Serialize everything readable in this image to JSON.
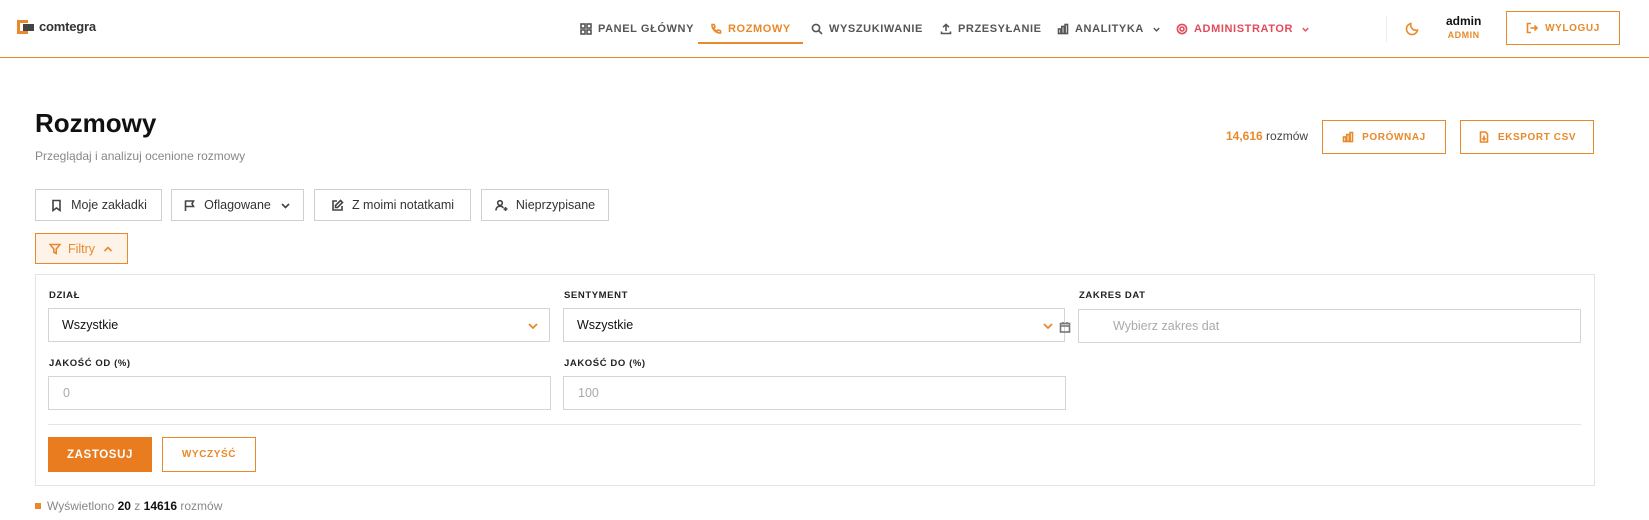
{
  "brand": {
    "name": "comtegra"
  },
  "nav": {
    "items": [
      {
        "label": "PANEL GŁÓWNY",
        "icon": "grid-icon"
      },
      {
        "label": "ROZMOWY",
        "icon": "phone-icon",
        "active": true
      },
      {
        "label": "WYSZUKIWANIE",
        "icon": "search-icon"
      },
      {
        "label": "PRZESYŁANIE",
        "icon": "upload-icon"
      },
      {
        "label": "ANALITYKA",
        "icon": "bar-chart-icon",
        "dropdown": true
      },
      {
        "label": "ADMINISTRATOR",
        "icon": "gear-icon",
        "dropdown": true
      }
    ],
    "theme_icon": "moon-icon",
    "user": {
      "name": "admin",
      "role": "ADMIN"
    },
    "logout_label": "WYLOGUJ"
  },
  "header": {
    "title": "Rozmowy",
    "subtitle": "Przeglądaj i analizuj ocenione rozmowy",
    "count_value": "14,616",
    "count_unit": "rozmów",
    "compare_label": "PORÓWNAJ",
    "export_label": "EKSPORT CSV"
  },
  "quick_filters": {
    "bookmarks": "Moje zakładki",
    "flagged": "Oflagowane",
    "notes": "Z moimi notatkami",
    "unassigned": "Nieprzypisane"
  },
  "filters": {
    "toggle_label": "Filtry",
    "department": {
      "label": "DZIAŁ",
      "value": "Wszystkie"
    },
    "sentiment": {
      "label": "SENTYMENT",
      "value": "Wszystkie"
    },
    "date_range": {
      "label": "ZAKRES DAT",
      "placeholder": "Wybierz zakres dat"
    },
    "quality_from": {
      "label": "JAKOŚĆ OD (%)",
      "placeholder": "0"
    },
    "quality_to": {
      "label": "JAKOŚĆ DO (%)",
      "placeholder": "100"
    },
    "apply_label": "ZASTOSUJ",
    "clear_label": "WYCZYŚĆ"
  },
  "results": {
    "prefix": "Wyświetlono",
    "shown": "20",
    "of": "z",
    "total": "14616",
    "suffix": "rozmów"
  },
  "colors": {
    "accent": "#e8892b",
    "admin": "#e24b5b",
    "apply_bg": "#e87c1e"
  }
}
